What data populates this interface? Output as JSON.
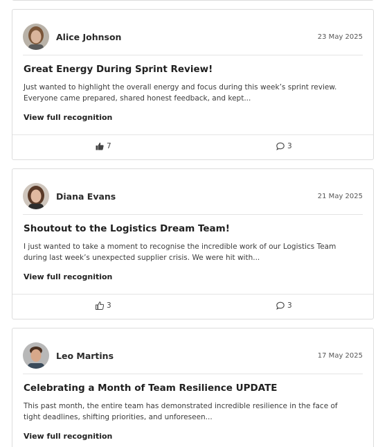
{
  "posts": [
    {
      "author": "Alice Johnson",
      "date": "23 May 2025",
      "title": "Great Energy During Sprint Review!",
      "excerpt": "Just wanted to highlight the overall energy and focus during this week’s sprint review. Everyone came prepared, shared honest feedback, and kept...",
      "view_label": "View full recognition",
      "likes": "7",
      "comments": "3",
      "liked": true,
      "avatar_colors": {
        "bg": "#b9b2a8",
        "skin": "#d9b49b",
        "hair": "#7a5538"
      }
    },
    {
      "author": "Diana Evans",
      "date": "21 May 2025",
      "title": "Shoutout to the Logistics Dream Team!",
      "excerpt": "I just wanted to take a moment to recognise the incredible work of our Logistics Team during last week’s unexpected supplier crisis. We were hit with...",
      "view_label": "View full recognition",
      "likes": "3",
      "comments": "3",
      "liked": false,
      "avatar_colors": {
        "bg": "#cfc6bd",
        "skin": "#e0b9a0",
        "hair": "#5a3a28"
      }
    },
    {
      "author": "Leo Martins",
      "date": "17 May 2025",
      "title": "Celebrating a Month of Team Resilience UPDATE",
      "excerpt": "This past month, the entire team has demonstrated incredible resilience in the face of tight deadlines, shifting priorities, and unforeseen...",
      "view_label": "View full recognition",
      "avatar_colors": {
        "bg": "#b8b8b8",
        "skin": "#d8a88a",
        "hair": "#4a3020"
      }
    }
  ],
  "icons": {
    "like": "thumbs-up-icon",
    "comment": "comment-bubble-icon"
  }
}
